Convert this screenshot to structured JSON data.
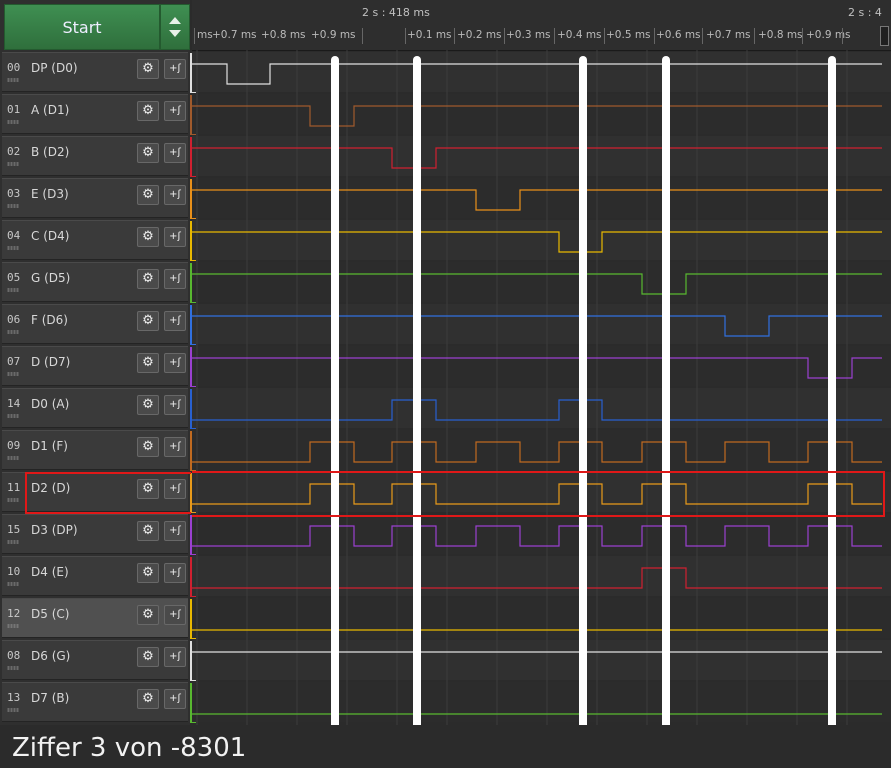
{
  "toolbar": {
    "start_label": "Start"
  },
  "timeline": {
    "header_label": "2 s : 418 ms",
    "header_label_right": "2 s : 4",
    "ticks": [
      "ms",
      "+0.7 ms",
      "+0.8 ms",
      "+0.9 ms",
      "+0.1 ms",
      "+0.2 ms",
      "+0.3 ms",
      "+0.4 ms",
      "+0.5 ms",
      "+0.6 ms",
      "+0.7 ms",
      "+0.8 ms",
      "+0.9 ms"
    ]
  },
  "channels": [
    {
      "index": "00",
      "name": "DP (D0)",
      "color": "#e0e0e0"
    },
    {
      "index": "01",
      "name": "A (D1)",
      "color": "#a05a2c"
    },
    {
      "index": "02",
      "name": "B (D2)",
      "color": "#d02030"
    },
    {
      "index": "03",
      "name": "E (D3)",
      "color": "#e8901a"
    },
    {
      "index": "04",
      "name": "C (D4)",
      "color": "#e8b800"
    },
    {
      "index": "05",
      "name": "G (D5)",
      "color": "#58b830"
    },
    {
      "index": "06",
      "name": "F (D6)",
      "color": "#3070e0"
    },
    {
      "index": "07",
      "name": "D (D7)",
      "color": "#9a40d0"
    },
    {
      "index": "14",
      "name": "D0 (A)",
      "color": "#2860d0"
    },
    {
      "index": "09",
      "name": "D1 (F)",
      "color": "#c06a20"
    },
    {
      "index": "11",
      "name": "D2 (D)",
      "color": "#e89a1a"
    },
    {
      "index": "15",
      "name": "D3 (DP)",
      "color": "#9a40d0"
    },
    {
      "index": "10",
      "name": "D4 (E)",
      "color": "#d02030"
    },
    {
      "index": "12",
      "name": "D5 (C)",
      "color": "#e8b800"
    },
    {
      "index": "08",
      "name": "D6 (G)",
      "color": "#e0e0e0"
    },
    {
      "index": "13",
      "name": "D7 (B)",
      "color": "#58b830"
    }
  ],
  "caption": "Ziffer 3 von -8301"
}
